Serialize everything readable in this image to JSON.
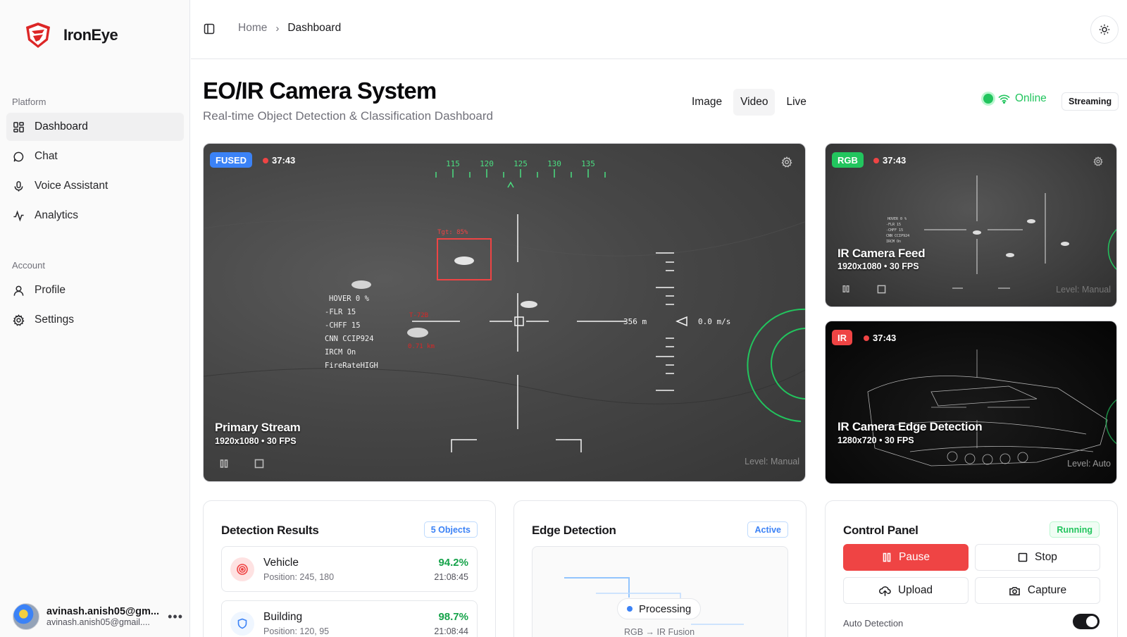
{
  "app": {
    "name": "IronEye"
  },
  "sidebar": {
    "platform_label": "Platform",
    "account_label": "Account",
    "platform_items": [
      {
        "label": "Dashboard",
        "icon": "dashboard-icon",
        "active": true
      },
      {
        "label": "Chat",
        "icon": "chat-icon"
      },
      {
        "label": "Voice Assistant",
        "icon": "mic-icon"
      },
      {
        "label": "Analytics",
        "icon": "analytics-icon"
      }
    ],
    "account_items": [
      {
        "label": "Profile",
        "icon": "user-icon"
      },
      {
        "label": "Settings",
        "icon": "gear-icon"
      }
    ],
    "user": {
      "name": "avinash.anish05@gm...",
      "email": "avinash.anish05@gmail...."
    }
  },
  "breadcrumb": {
    "home": "Home",
    "current": "Dashboard"
  },
  "header": {
    "title": "EO/IR Camera System",
    "subtitle": "Real-time Object Detection & Classification Dashboard",
    "tabs": [
      "Image",
      "Video",
      "Live"
    ],
    "active_tab": "Video",
    "status": "Online",
    "stream_badge": "Streaming"
  },
  "feeds": {
    "main": {
      "badge": "FUSED",
      "badge_color": "#3b82f6",
      "time": "37:43",
      "name": "Primary Stream",
      "meta": "1920x1080 • 30 FPS",
      "level": "Level: Manual",
      "hud": {
        "compass": [
          "115",
          "120",
          "125",
          "130",
          "135"
        ],
        "status_lines": [
          "HOVER  0 %",
          "-FLR   15",
          "-CHFF  15",
          " CNN CCIP924",
          " IRCM  On",
          " FireRateHIGH"
        ],
        "range": "356 m",
        "speed": "0.0 m/s",
        "target_label": "Tgt: 85%",
        "target2_label": "T-72B",
        "target2_range": "0.71 km"
      }
    },
    "rgb": {
      "badge": "RGB",
      "badge_color": "#22c55e",
      "time": "37:43",
      "name": "IR Camera Feed",
      "meta": "1920x1080 • 30 FPS",
      "level": "Level: Manual"
    },
    "ir": {
      "badge": "IR",
      "badge_color": "#ef4444",
      "time": "37:43",
      "name": "IR Camera Edge Detection",
      "meta": "1280x720 • 30 FPS",
      "level": "Level: Auto"
    }
  },
  "detection": {
    "title": "Detection Results",
    "badge": "5 Objects",
    "items": [
      {
        "name": "Vehicle",
        "position": "Position: 245, 180",
        "confidence": "94.2%",
        "time": "21:08:45",
        "icon": "target-icon"
      },
      {
        "name": "Building",
        "position": "Position: 120, 95",
        "confidence": "98.7%",
        "time": "21:08:44",
        "icon": "shield-icon"
      }
    ]
  },
  "edge": {
    "title": "Edge Detection",
    "badge": "Active",
    "processing": "Processing",
    "fusion": "RGB → IR Fusion"
  },
  "control": {
    "title": "Control Panel",
    "badge": "Running",
    "pause": "Pause",
    "stop": "Stop",
    "upload": "Upload",
    "capture": "Capture",
    "auto_detection": "Auto Detection",
    "auto_detection_on": true
  }
}
